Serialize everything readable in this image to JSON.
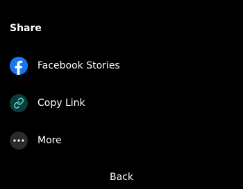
{
  "share": {
    "title": "Share",
    "options": [
      {
        "label": "Facebook Stories",
        "icon": "facebook-icon",
        "icon_bg": "#1877f2"
      },
      {
        "label": "Copy Link",
        "icon": "link-icon",
        "icon_bg": "#0f3b3b",
        "icon_color": "#5ce1d6"
      },
      {
        "label": "More",
        "icon": "more-dots-icon",
        "icon_bg": "#2b2b2b"
      }
    ],
    "back_label": "Back"
  }
}
